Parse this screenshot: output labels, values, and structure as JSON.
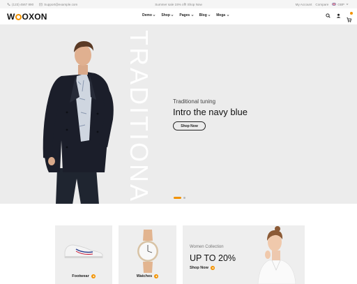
{
  "topbar": {
    "phone": "(123) 4567 890",
    "email": "Support@example.com",
    "promo": "Summer sale 15% off! Shop Now",
    "my_account": "My Account",
    "compare": "Compare",
    "currency": "GBP"
  },
  "header": {
    "logo_text": "WOOXON",
    "nav": [
      "Demo",
      "Shop",
      "Pages",
      "Blog",
      "Mega"
    ],
    "cart_count": ""
  },
  "hero": {
    "vertical_text": "TRADITIONAL",
    "subtitle": "Traditional tuning",
    "headline": "Intro the navy blue",
    "button": "Shop Now"
  },
  "banners": {
    "footwear": "Footwear",
    "watches": "Watches",
    "collection_label": "Women Collection",
    "collection_offer": "UP TO 20%",
    "collection_button": "Shop Now"
  },
  "colors": {
    "accent": "#f29200",
    "hero_bg": "#ececec",
    "card_bg": "#eeeeee"
  }
}
